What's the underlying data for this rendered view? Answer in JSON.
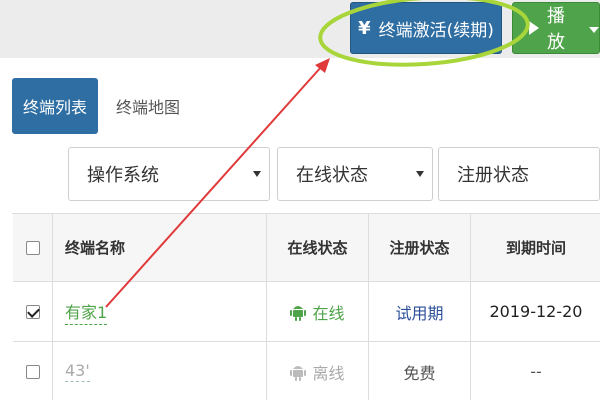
{
  "toolbar": {
    "activate_label": "终端激活(续期)",
    "play_label": "播放"
  },
  "tabs": [
    {
      "label": "终端列表",
      "active": true
    },
    {
      "label": "终端地图",
      "active": false
    }
  ],
  "filters": [
    {
      "label": "操作系统"
    },
    {
      "label": "在线状态"
    },
    {
      "label": "注册状态"
    }
  ],
  "table": {
    "headers": {
      "name": "终端名称",
      "online": "在线状态",
      "reg": "注册状态",
      "expire": "到期时间"
    },
    "rows": [
      {
        "checked": true,
        "name": "有家1",
        "online": "在线",
        "reg": "试用期",
        "expire": "2019-12-20"
      },
      {
        "checked": false,
        "name": "43'",
        "online": "离线",
        "reg": "免费",
        "expire": "--"
      }
    ]
  },
  "colors": {
    "primary_blue": "#2f6ea3",
    "play_green": "#4fa34a",
    "annotation_circle": "#a8d63a",
    "annotation_arrow": "#e03a3a"
  }
}
